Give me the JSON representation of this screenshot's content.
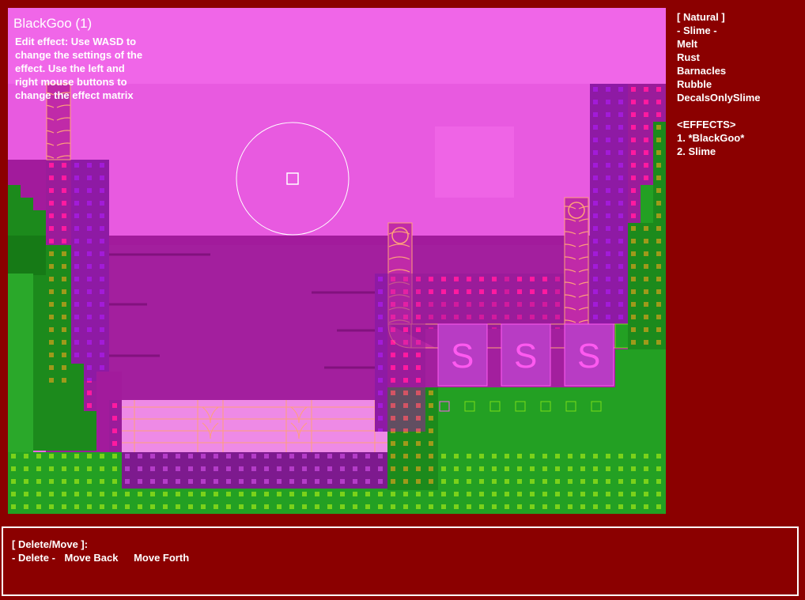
{
  "editor": {
    "effect_title": "BlackGoo (1)",
    "instructions": "Edit effect: Use WASD to change the settings of the effect. Use the left and right mouse buttons to change the effect matrix"
  },
  "categories": {
    "header": "[ Natural ]",
    "items": [
      "- Slime -",
      "Melt",
      "Rust",
      "Barnacles",
      "Rubble",
      "DecalsOnlySlime"
    ],
    "selected": "Slime"
  },
  "effects": {
    "header": "<EFFECTS>",
    "items": [
      "1. *BlackGoo*",
      "2. Slime"
    ]
  },
  "bottom_panel": {
    "header": "[ Delete/Move ]:",
    "options": [
      "- Delete -",
      "Move Back",
      "Move Forth"
    ]
  },
  "colors": {
    "background": "#8b0000",
    "sky": "#f066e8",
    "wall": "#a21b9c",
    "grass": "#23a023",
    "pipe": "#f0a0f0",
    "panel_border": "#ffffff"
  },
  "scene": {
    "brush_cursor": "circle-with-square",
    "tile_glyph": "S"
  }
}
